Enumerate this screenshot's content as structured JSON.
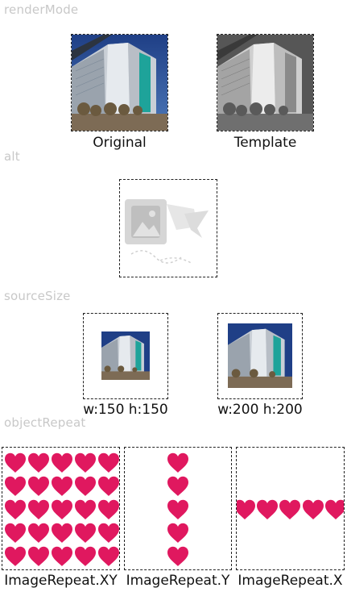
{
  "sections": {
    "render_mode": "renderMode",
    "alt": "alt",
    "source_size": "sourceSize",
    "object_repeat": "objectRepeat"
  },
  "render_mode": {
    "original_label": "Original",
    "template_label": "Template"
  },
  "source_size": {
    "small_label": "w:150 h:150",
    "large_label": "w:200 h:200"
  },
  "object_repeat": {
    "xy_label": "ImageRepeat.XY",
    "y_label": "ImageRepeat.Y",
    "x_label": "ImageRepeat.X"
  },
  "colors": {
    "heart": "#e0185f",
    "section_label": "#c8c8c8"
  }
}
